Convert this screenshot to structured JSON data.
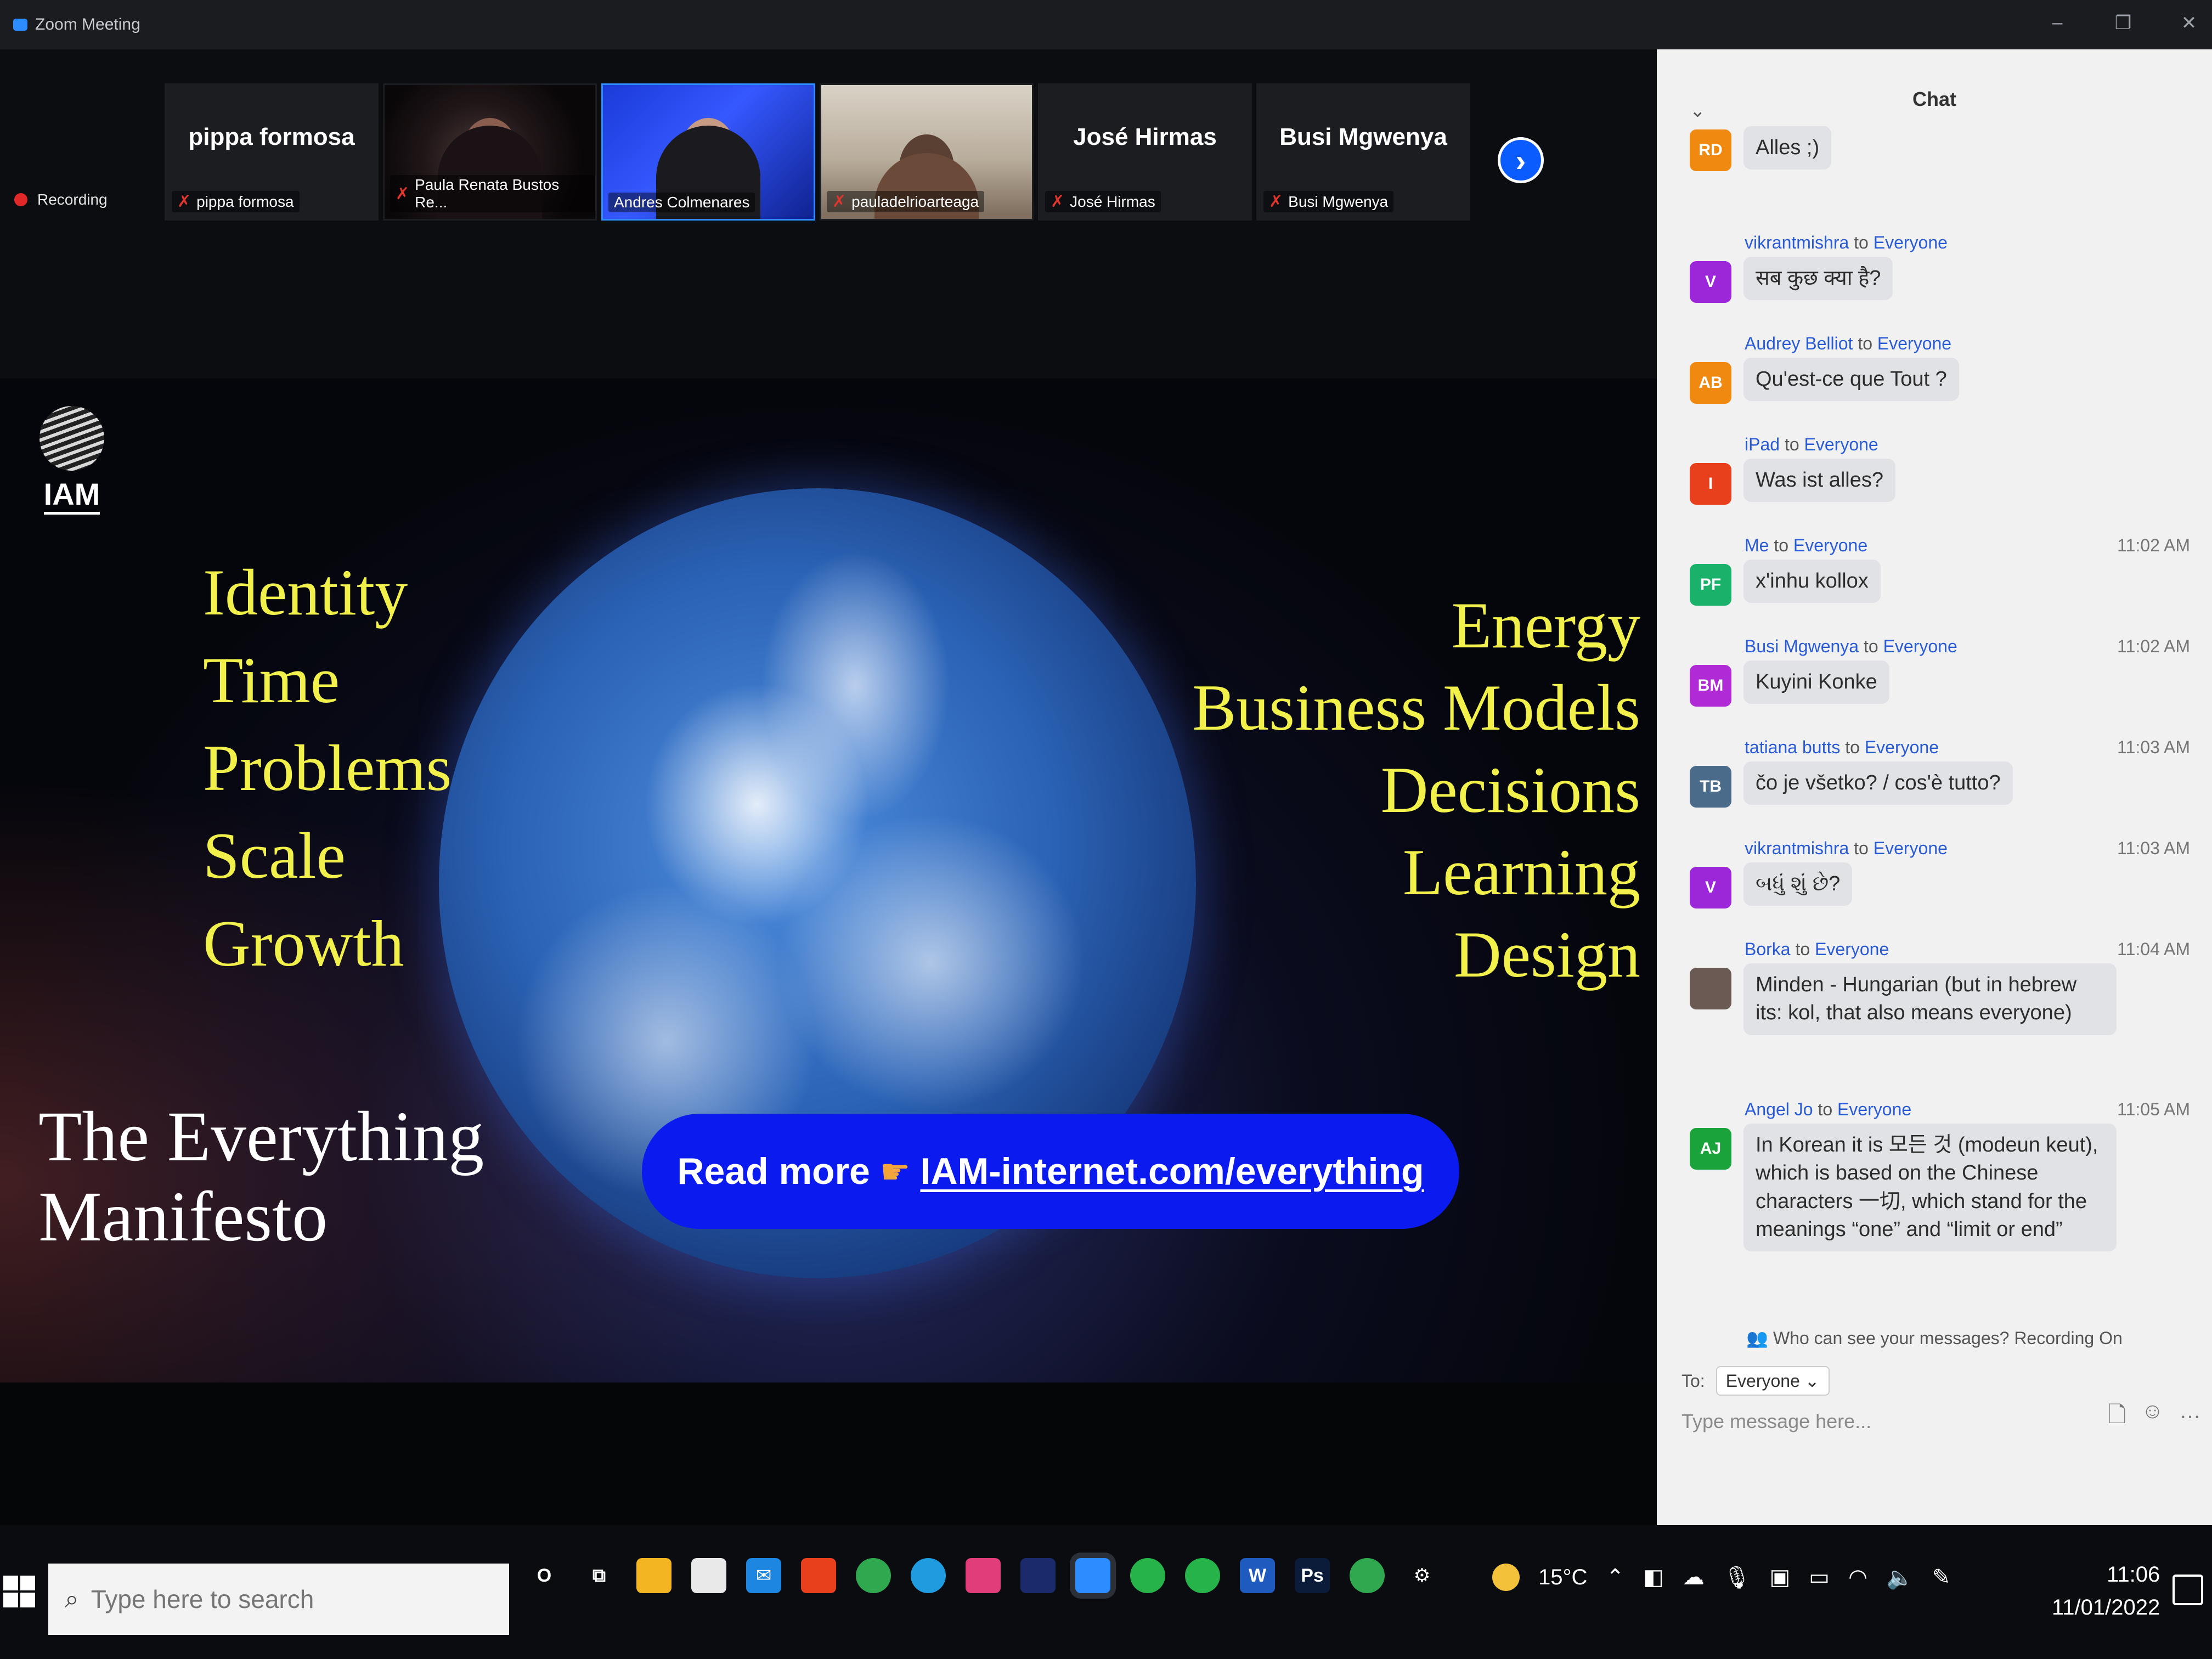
{
  "window": {
    "title": "Zoom Meeting"
  },
  "recording": {
    "label": "Recording"
  },
  "participants": [
    {
      "title": "pippa formosa",
      "name": "pippa formosa",
      "muted": true,
      "video": false
    },
    {
      "title": "",
      "name": "Paula Renata Bustos Re...",
      "muted": true,
      "video": true
    },
    {
      "title": "",
      "name": "Andres Colmenares",
      "muted": false,
      "video": true,
      "active": true
    },
    {
      "title": "",
      "name": "pauladelrioarteaga",
      "muted": true,
      "video": true
    },
    {
      "title": "José Hirmas",
      "name": "José Hirmas",
      "muted": true,
      "video": false
    },
    {
      "title": "Busi Mgwenya",
      "name": "Busi Mgwenya",
      "muted": true,
      "video": false
    }
  ],
  "slide": {
    "logo": "IAM",
    "left_words": [
      "Identity",
      "Time",
      "Problems",
      "Scale",
      "Growth"
    ],
    "right_words": [
      "Energy",
      "Business Models",
      "Decisions",
      "Learning",
      "Design"
    ],
    "manifesto_line1": "The Everything",
    "manifesto_line2": "Manifesto",
    "read_more_label": "Read more",
    "read_more_icon": "pointing-hand-icon",
    "read_more_link": "IAM-internet.com/everything"
  },
  "chat": {
    "title": "Chat",
    "messages": [
      {
        "avatar": "RD",
        "color": "#f0890f",
        "sender": "",
        "to": "",
        "time": "",
        "text": "Alles ;)"
      },
      {
        "avatar": "V",
        "color": "#9b27d8",
        "sender": "vikrantmishra",
        "to": "Everyone",
        "time": "",
        "text": "सब कुछ क्या है?"
      },
      {
        "avatar": "AB",
        "color": "#f0890f",
        "sender": "Audrey Belliot",
        "to": "Everyone",
        "time": "",
        "text": "Qu'est-ce que Tout ?"
      },
      {
        "avatar": "I",
        "color": "#e8401c",
        "sender": "iPad",
        "to": "Everyone",
        "time": "",
        "text": "Was ist alles?"
      },
      {
        "avatar": "PF",
        "color": "#1ab26b",
        "sender": "Me",
        "to": "Everyone",
        "time": "11:02 AM",
        "text": "x'inhu kollox"
      },
      {
        "avatar": "BM",
        "color": "#b02ad6",
        "sender": "Busi Mgwenya",
        "to": "Everyone",
        "time": "11:02 AM",
        "text": "Kuyini Konke"
      },
      {
        "avatar": "TB",
        "color": "#4b6b8a",
        "sender": "tatiana butts",
        "to": "Everyone",
        "time": "11:03 AM",
        "text": "čo je všetko? / cos'è tutto?"
      },
      {
        "avatar": "V",
        "color": "#9b27d8",
        "sender": "vikrantmishra",
        "to": "Everyone",
        "time": "11:03 AM",
        "text": "બધું શું છે?"
      },
      {
        "avatar": "",
        "color": "#6b5a54",
        "sender": "Borka",
        "to": "Everyone",
        "time": "11:04 AM",
        "text": "Minden - Hungarian (but in hebrew its: kol, that also means everyone)"
      },
      {
        "avatar": "AJ",
        "color": "#1aa33a",
        "sender": "Angel Jo",
        "to": "Everyone",
        "time": "11:05 AM",
        "text": "In Korean it is 모든 것 (modeun keut), which is based on the Chinese characters 一切, which stand for the meanings “one” and “limit or end”"
      }
    ],
    "to_word": "to",
    "privacy_note": "Who can see your messages? Recording On",
    "to_label": "To:",
    "recipient": "Everyone",
    "compose_placeholder": "Type message here..."
  },
  "taskbar": {
    "search_placeholder": "Type here to search",
    "apps": [
      {
        "name": "cortana",
        "glyph": "O",
        "color": "transparent"
      },
      {
        "name": "task-view",
        "glyph": "⧉",
        "color": "transparent"
      },
      {
        "name": "file-explorer",
        "glyph": "",
        "color": "#f3b521"
      },
      {
        "name": "store",
        "glyph": "",
        "color": "#e9e9e9"
      },
      {
        "name": "mail",
        "glyph": "✉",
        "color": "#1c86e0"
      },
      {
        "name": "office",
        "glyph": "",
        "color": "#e8401c"
      },
      {
        "name": "chrome",
        "glyph": "",
        "color": "#2fa84f"
      },
      {
        "name": "edge",
        "glyph": "",
        "color": "#1f9be0"
      },
      {
        "name": "instagram",
        "glyph": "",
        "color": "#e13d7a"
      },
      {
        "name": "app-dark",
        "glyph": "",
        "color": "#1a2a6b"
      },
      {
        "name": "zoom",
        "glyph": "",
        "color": "#2d8cff"
      },
      {
        "name": "green-app-1",
        "glyph": "",
        "color": "#26b34a"
      },
      {
        "name": "green-app-2",
        "glyph": "",
        "color": "#26b34a"
      },
      {
        "name": "word",
        "glyph": "W",
        "color": "#1f5bbf"
      },
      {
        "name": "photoshop",
        "glyph": "Ps",
        "color": "#0b1c3a"
      },
      {
        "name": "chrome-2",
        "glyph": "",
        "color": "#2fa84f"
      },
      {
        "name": "settings",
        "glyph": "⚙",
        "color": "transparent"
      }
    ],
    "temperature": "15°C",
    "time": "11:06",
    "date": "11/01/2022"
  }
}
